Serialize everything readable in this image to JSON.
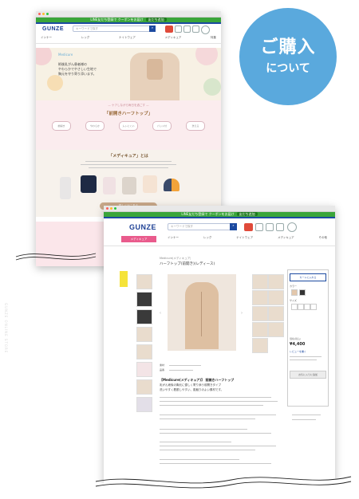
{
  "badge": {
    "line1": "ご購入",
    "line2": "について",
    "color": "#5aa9dd"
  },
  "window1": {
    "top_banner": "LINE友だち登録で クーポンをお届け",
    "top_banner_pill": "友だち追加",
    "logo": "GUNZE",
    "search_placeholder": "キーワードで探す",
    "nav": [
      "インナー",
      "レッグ",
      "ナイトウェア",
      "メディキュア",
      "特集"
    ],
    "hero_brand": "Medicure",
    "hero_text_1": "術後乳がん患者様の",
    "hero_text_2": "やわらかでやさしい生地で",
    "hero_text_3": "胸元を守り寄り添います。",
    "pink_sub": "— ケアしながら毎日を過ごす —",
    "pink_title": "「前開きハーフトップ」",
    "chips": [
      "前開き",
      "やわらか",
      "ムレにくい",
      "パッド付",
      "洗える"
    ],
    "section_title": "「メディキュア」とは",
    "cta": "詳しくはこちら"
  },
  "window2": {
    "top_banner": "LINE友だち登録で クーポンをお届け",
    "top_banner_pill": "友だち追加",
    "logo": "GUNZE",
    "search_placeholder": "キーワードで探す",
    "menu_pink": "メディキュア",
    "nav": [
      "インナー",
      "レッグ",
      "ナイトウェア",
      "メディキュア",
      "その他"
    ],
    "breadcrumb": "Medicure(メディキュア)",
    "product_name": "ハーフトップ(前開き)(レディース)",
    "cart_button": "カートに入れる",
    "color_label": "カラー",
    "size_label": "サイズ",
    "price": "¥4,400",
    "price_label": "価格(税込)",
    "review_label": "レビューを書く",
    "fav_button": "お気に入りに追加",
    "desc_title": "【Medicure(メディキュア)】 前開きハーフトップ",
    "desc_line1": "乳がん術後の胸元に優しく寄り添う前開きタイプ",
    "desc_line2": "洗いやすく着脱しやすい、肌触りのよい素材です。",
    "spec_label_1": "素材",
    "spec_label_2": "品番"
  },
  "side_text": "GUNZE ONLINE STORE"
}
